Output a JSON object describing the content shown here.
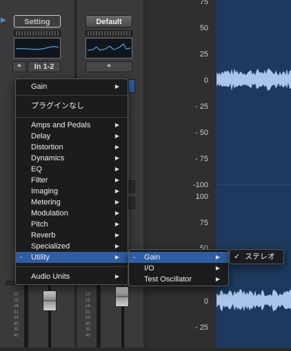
{
  "channel1": {
    "setting_label": "Setting",
    "io_label": "In 1-2",
    "link_icon": "link-icon"
  },
  "channel2": {
    "default_label": "Default",
    "link_icon": "link-icon"
  },
  "ruler_top": [
    "75",
    "50",
    "25",
    "0",
    "- 25",
    "- 50",
    "- 75",
    "-100"
  ],
  "ruler_bottom": [
    "100",
    "75",
    "50",
    "0",
    "- 25"
  ],
  "plugin_menu": {
    "items": [
      {
        "label": "Gain",
        "submenu": true
      },
      {
        "label": "プラグインなし",
        "submenu": false
      },
      {
        "label": "Amps and Pedals",
        "submenu": true
      },
      {
        "label": "Delay",
        "submenu": true
      },
      {
        "label": "Distortion",
        "submenu": true
      },
      {
        "label": "Dynamics",
        "submenu": true
      },
      {
        "label": "EQ",
        "submenu": true
      },
      {
        "label": "Filter",
        "submenu": true
      },
      {
        "label": "Imaging",
        "submenu": true
      },
      {
        "label": "Metering",
        "submenu": true
      },
      {
        "label": "Modulation",
        "submenu": true
      },
      {
        "label": "Pitch",
        "submenu": true
      },
      {
        "label": "Reverb",
        "submenu": true
      },
      {
        "label": "Specialized",
        "submenu": true
      },
      {
        "label": "Utility",
        "submenu": true,
        "selected": true,
        "marker": "-"
      },
      {
        "label": "Audio Units",
        "submenu": true
      }
    ]
  },
  "utility_menu": {
    "items": [
      {
        "label": "Gain",
        "submenu": true,
        "selected": true,
        "marker": "-"
      },
      {
        "label": "I/O",
        "submenu": true
      },
      {
        "label": "Test Oscillator",
        "submenu": true
      }
    ]
  },
  "gain_menu": {
    "items": [
      {
        "label": "ステレオ",
        "checked": true,
        "check": "✓"
      }
    ]
  },
  "scale_marks": [
    "12",
    "15",
    "18",
    "21",
    "24",
    "30",
    "35",
    "40"
  ],
  "colors": {
    "menu_highlight": "#2f5da4",
    "waveform": "#a9c6ea",
    "wave_bg": "#1d3a5e"
  }
}
